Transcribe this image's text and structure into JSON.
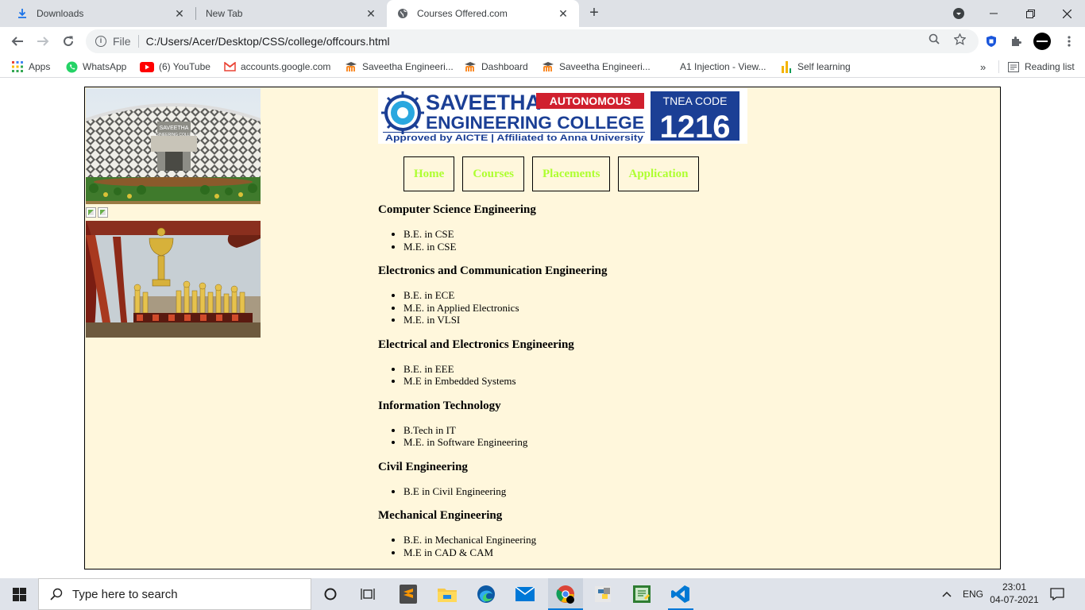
{
  "browser": {
    "tabs": [
      {
        "title": "Downloads",
        "favicon": "download-icon",
        "active": false
      },
      {
        "title": "New Tab",
        "favicon": "none",
        "active": false
      },
      {
        "title": "Courses Offered.com",
        "favicon": "globe-icon",
        "active": true
      }
    ],
    "address": {
      "scheme": "File",
      "url": "C:/Users/Acer/Desktop/CSS/college/offcours.html"
    },
    "bookmarks": [
      {
        "label": "Apps",
        "icon": "apps-grid-icon"
      },
      {
        "label": "WhatsApp",
        "icon": "whatsapp-icon"
      },
      {
        "label": "(6) YouTube",
        "icon": "youtube-icon"
      },
      {
        "label": "accounts.google.com",
        "icon": "gmail-icon"
      },
      {
        "label": "Saveetha Engineeri...",
        "icon": "moodle-icon"
      },
      {
        "label": "Dashboard",
        "icon": "moodle-icon"
      },
      {
        "label": "Saveetha Engineeri...",
        "icon": "moodle-icon"
      },
      {
        "label": "A1 Injection - View...",
        "icon": "blank-page-icon"
      },
      {
        "label": "Self learning",
        "icon": "chart-bars-icon"
      }
    ],
    "reading_list": "Reading list"
  },
  "page": {
    "logo": {
      "name_line1": "SAVEETHA",
      "name_line2": "ENGINEERING COLLEGE",
      "autonomous": "AUTONOMOUS",
      "tagline": "Approved by AICTE  |  Affiliated to Anna University",
      "tnea_label": "TNEA CODE",
      "tnea_code": "1216"
    },
    "campus_sign": "SAVEETHA ENGINEERING COLLEGE",
    "nav": [
      "Home",
      "Courses",
      "Placements",
      "Application"
    ],
    "departments": [
      {
        "title": "Computer Science Engineering",
        "courses": [
          "B.E. in CSE",
          "M.E. in CSE"
        ]
      },
      {
        "title": "Electronics and Communication Engineering",
        "courses": [
          "B.E. in ECE",
          "M.E. in Applied Electronics",
          "M.E. in VLSI"
        ]
      },
      {
        "title": "Electrical and Electronics Engineering",
        "courses": [
          "B.E. in EEE",
          "M.E in Embedded Systems"
        ]
      },
      {
        "title": "Information Technology",
        "courses": [
          "B.Tech in IT",
          "M.E. in Software Engineering"
        ]
      },
      {
        "title": "Civil Engineering",
        "courses": [
          "B.E in Civil Engineering"
        ]
      },
      {
        "title": "Mechanical Engineering",
        "courses": [
          "B.E. in Mechanical Engineering",
          "M.E in CAD & CAM"
        ]
      }
    ]
  },
  "taskbar": {
    "search_placeholder": "Type here to search",
    "language": "ENG",
    "time": "23:01",
    "date": "04-07-2021"
  },
  "colors": {
    "nav_text": "#adff2f",
    "page_bg": "#fff7dc",
    "logo_blue": "#1b3f95",
    "logo_red": "#d0202e"
  }
}
